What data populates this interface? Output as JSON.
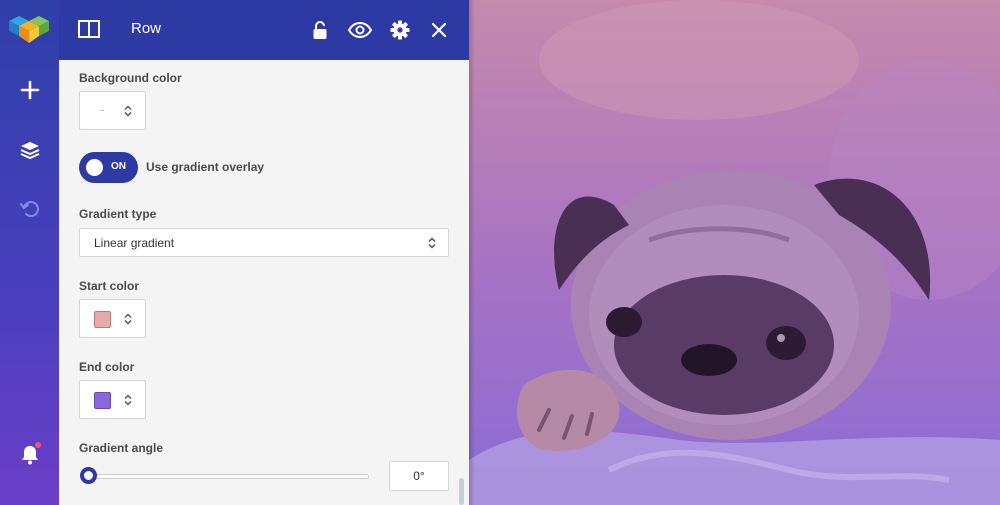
{
  "panel": {
    "title": "Row"
  },
  "fields": {
    "background_color": {
      "label": "Background color",
      "value": "-"
    },
    "gradient_overlay": {
      "toggle_state": "ON",
      "label": "Use gradient overlay"
    },
    "gradient_type": {
      "label": "Gradient type",
      "value": "Linear gradient"
    },
    "start_color": {
      "label": "Start color",
      "swatch": "#e8aaa9"
    },
    "end_color": {
      "label": "End color",
      "swatch": "#8b67e0"
    },
    "gradient_angle": {
      "label": "Gradient angle",
      "value": "0°",
      "slider_fraction": 0
    }
  },
  "colors": {
    "accent": "#2e3aa3",
    "navbar_top": "#2e3fa8",
    "navbar_bottom": "#6a3fc7",
    "notification": "#ff4f6b"
  },
  "icons": {
    "navbar": [
      "logo-icon",
      "plus-icon",
      "layers-icon",
      "undo-icon",
      "bell-icon"
    ],
    "header": [
      "layout-icon",
      "lock-icon",
      "eye-icon",
      "gear-icon",
      "close-icon"
    ]
  }
}
